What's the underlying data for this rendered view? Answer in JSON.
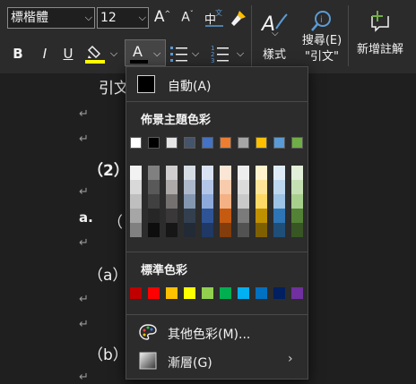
{
  "ribbon": {
    "font_name": "標楷體",
    "font_size": "12",
    "grow_font_label": "A",
    "shrink_font_label": "A",
    "bold_label": "B",
    "italic_label": "I",
    "underline_label": "U",
    "font_color_label": "A",
    "styles_label": "樣式",
    "search_label_1": "搜尋(E)",
    "search_label_2": "\"引文\"",
    "new_comment_label": "新增註解",
    "highlight_color": "#ffff00",
    "font_color": "#000000"
  },
  "document": {
    "line1": "引文",
    "heading2": "（2）",
    "item_a": "a.",
    "item_a_paren": "（",
    "item_paren_a": "（a）",
    "item_paren_b": "（b）"
  },
  "font_color_menu": {
    "automatic_label": "自動(A)",
    "theme_colors_header": "佈景主題色彩",
    "theme_colors": [
      "#ffffff",
      "#000000",
      "#e7e6e6",
      "#44546a",
      "#4472c4",
      "#ed7d31",
      "#a5a5a5",
      "#ffc000",
      "#5b9bd5",
      "#70ad47"
    ],
    "theme_shades": [
      [
        "#f2f2f2",
        "#d9d9d9",
        "#bfbfbf",
        "#a6a6a6",
        "#808080"
      ],
      [
        "#808080",
        "#595959",
        "#404040",
        "#262626",
        "#0d0d0d"
      ],
      [
        "#d0cece",
        "#aeaaaa",
        "#757171",
        "#3a3838",
        "#171616"
      ],
      [
        "#d6dce4",
        "#adb9ca",
        "#8497b0",
        "#333f4f",
        "#222a35"
      ],
      [
        "#d9e2f3",
        "#b4c6e7",
        "#8eaadb",
        "#2f5496",
        "#1f3864"
      ],
      [
        "#fbe5d5",
        "#f7cbac",
        "#f4b183",
        "#c55a11",
        "#833c0b"
      ],
      [
        "#ededed",
        "#dbdbdb",
        "#c9c9c9",
        "#7b7b7b",
        "#525252"
      ],
      [
        "#fff2cc",
        "#ffe598",
        "#ffd965",
        "#bf9000",
        "#7f6000"
      ],
      [
        "#deebf6",
        "#bdd7ee",
        "#9dc3e6",
        "#2e75b5",
        "#1f4e79"
      ],
      [
        "#e2efd9",
        "#c5e0b3",
        "#a8d08d",
        "#538135",
        "#375623"
      ]
    ],
    "standard_colors_header": "標準色彩",
    "standard_colors": [
      "#c00000",
      "#ff0000",
      "#ffc000",
      "#ffff00",
      "#92d050",
      "#00b050",
      "#00b0f0",
      "#0070c0",
      "#002060",
      "#7030a0"
    ],
    "more_colors_label": "其他色彩(M)...",
    "gradient_label": "漸層(G)"
  }
}
